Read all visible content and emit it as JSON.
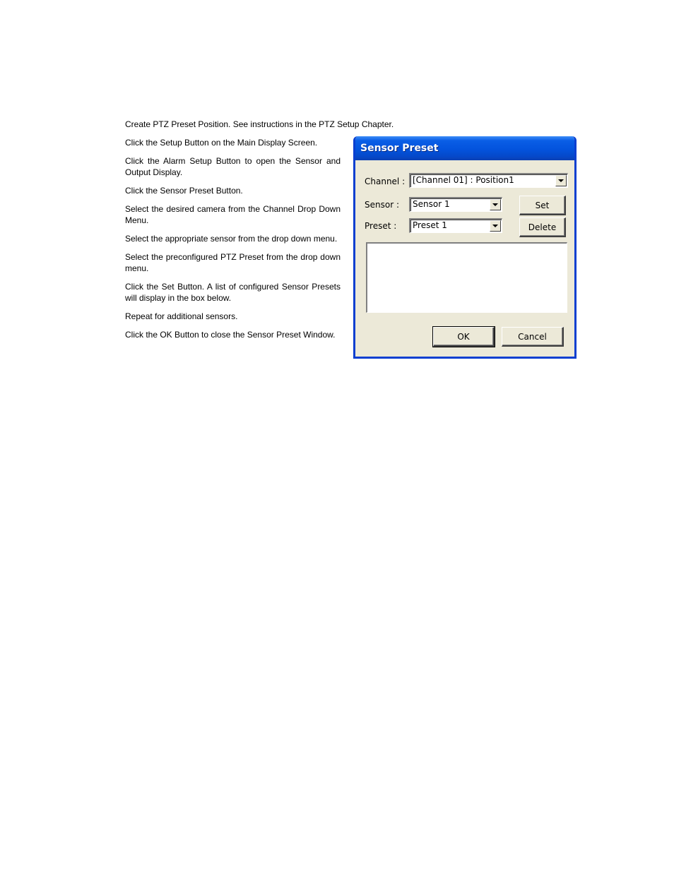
{
  "doc": {
    "intro": "Create PTZ Preset Position.  See instructions in the PTZ Setup Chapter.",
    "steps": [
      "Click the Setup Button on the Main Display Screen.",
      "Click the Alarm Setup Button to open the Sensor and Output Display.",
      "Click the Sensor Preset Button.",
      "Select the desired camera from the Channel Drop Down Menu.",
      "Select the appropriate sensor from the drop down menu.",
      "Select the preconfigured PTZ Preset from the drop down menu.",
      "Click the Set Button.  A list of configured Sensor Presets will display in the box below.",
      "Repeat for additional sensors.",
      "Click the OK Button to close the Sensor Preset Window."
    ]
  },
  "dialog": {
    "title": "Sensor Preset",
    "channel_label": "Channel :",
    "channel_value": "[Channel 01] : Position1",
    "sensor_label": "Sensor :",
    "sensor_value": "Sensor 1",
    "preset_label": "Preset :",
    "preset_value": "Preset 1",
    "set_button": "Set",
    "delete_button": "Delete",
    "ok_button": "OK",
    "cancel_button": "Cancel",
    "titlebar_color": "#0353dd",
    "face_color": "#ece9d8"
  }
}
